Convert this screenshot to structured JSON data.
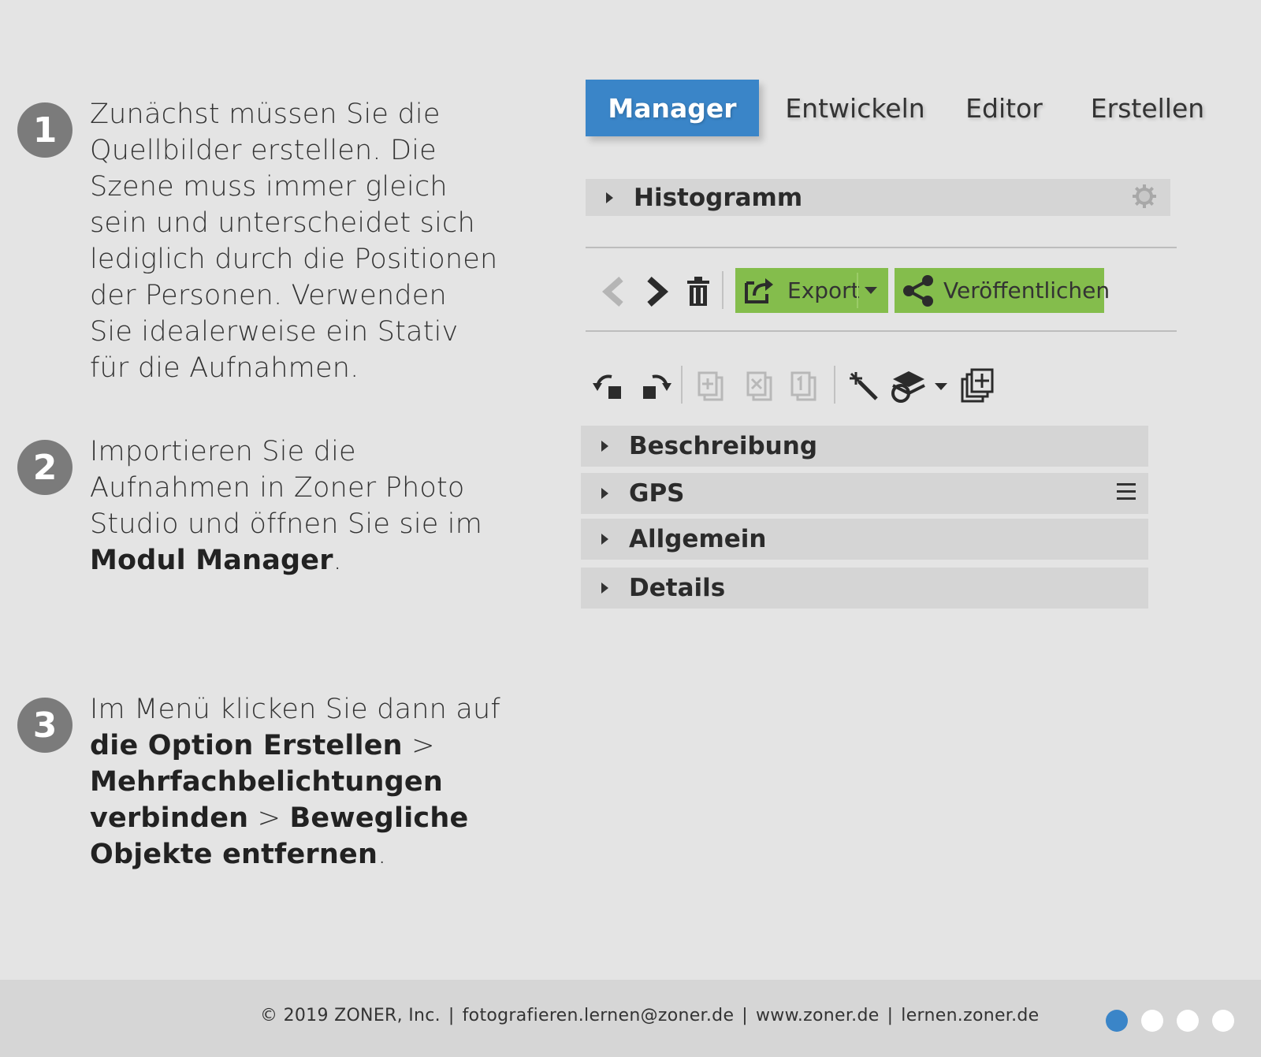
{
  "steps": [
    {
      "number": "1",
      "lines": [
        "Zunächst müssen Sie die",
        "Quellbilder erstellen. Die",
        "Szene muss immer gleich",
        "sein und unterscheidet sich",
        "lediglich durch die Positionen",
        "der Personen. Verwenden",
        "Sie idealerweise ein Stativ",
        "für die Aufnahmen."
      ]
    },
    {
      "number": "2",
      "lines": [
        "Importieren Sie die",
        "Aufnahmen in Zoner Photo",
        "Studio und öffnen Sie sie im"
      ],
      "bold": "Modul Manager",
      "tail": "."
    },
    {
      "number": "3",
      "intro": "Im Menü klicken Sie dann auf",
      "bold1": "die Option Erstellen",
      "sep1": " >",
      "bold2": "Mehrfachbelichtungen",
      "bold3": "verbinden",
      "sep2": " > ",
      "bold4": "Bewegliche",
      "bold5": "Objekte entfernen",
      "tail": "."
    }
  ],
  "tabs": {
    "manager": "Manager",
    "develop": "Entwickeln",
    "editor": "Editor",
    "create": "Erstellen"
  },
  "histogram": {
    "label": "Histogramm"
  },
  "toolbar": {
    "export_label": "Export",
    "publish_label": "Veröffentlichen"
  },
  "panels": {
    "description": "Beschreibung",
    "gps": "GPS",
    "general": "Allgemein",
    "details": "Details"
  },
  "footer": {
    "copyright": "© 2019 ZONER, Inc.",
    "email": "fotografieren.lernen@zoner.de",
    "website": "www.zoner.de",
    "learn": "lernen.zoner.de",
    "separator": "|"
  },
  "pagination": {
    "current": 1,
    "total": 4
  },
  "colors": {
    "accent": "#3a85c8",
    "green_button": "#84bd4c",
    "step_circle": "#7b7b7b",
    "panel_bg": "#d5d5d5"
  }
}
